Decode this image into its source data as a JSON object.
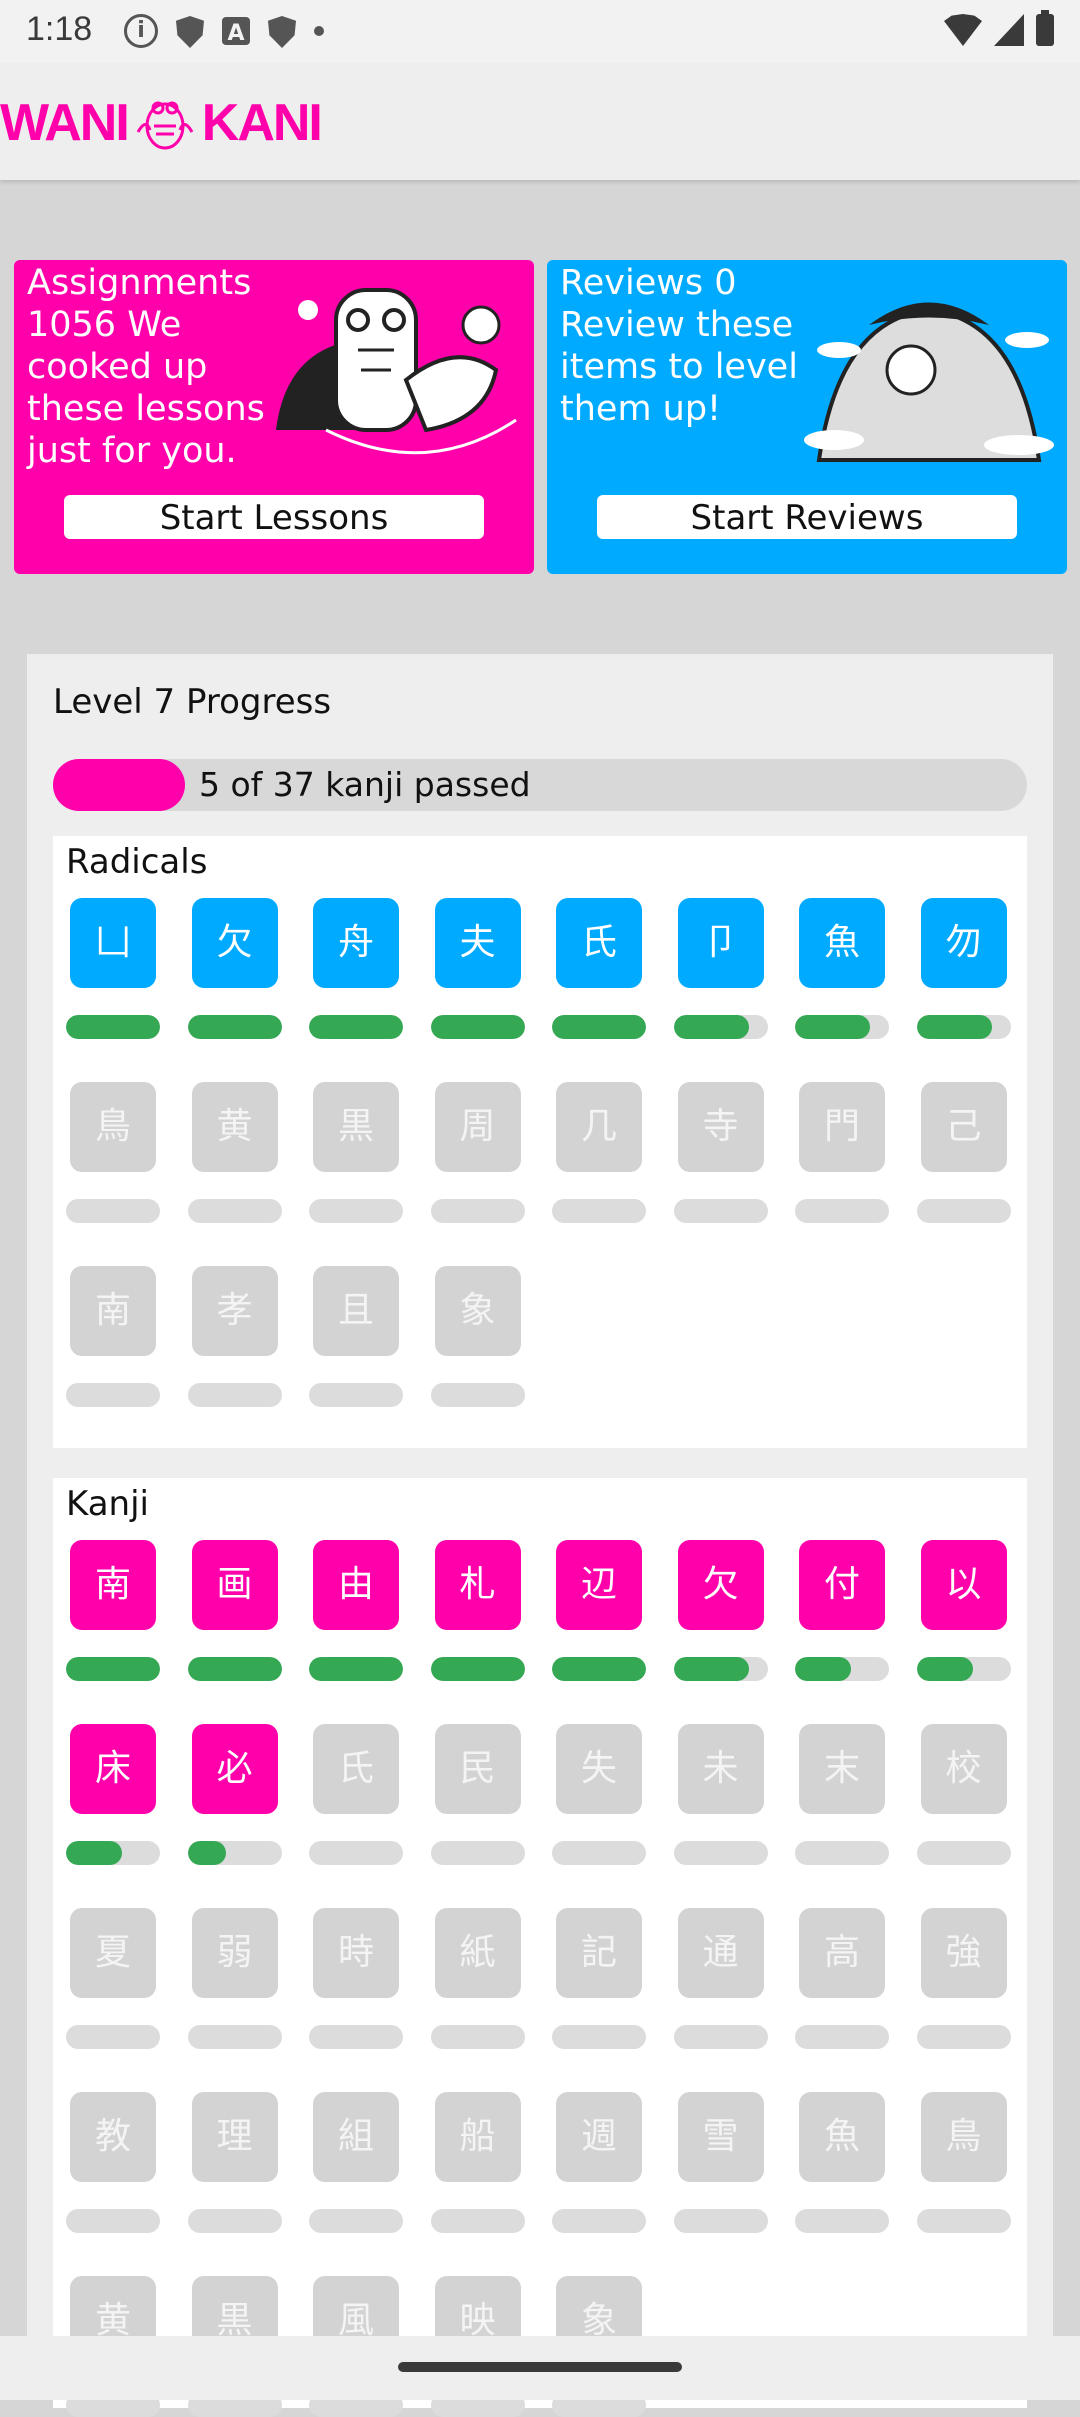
{
  "status_bar": {
    "time": "1:18"
  },
  "app_bar": {
    "logo_left": "WANI",
    "logo_right": "KANI"
  },
  "lessons_card": {
    "text": "Assignments 1056 We cooked up these lessons just for you.",
    "button": "Start Lessons",
    "color": "#ff00aa"
  },
  "reviews_card": {
    "text": "Reviews 0 Review these items to level them up!",
    "button": "Start Reviews",
    "color": "#00aaff"
  },
  "progress": {
    "title": "Level 7 Progress",
    "text": "5 of 37 kanji passed",
    "passed": 5,
    "total": 37
  },
  "radicals": {
    "title": "Radicals",
    "items": [
      {
        "char": "凵",
        "state": "unlocked",
        "progress": 1.0
      },
      {
        "char": "欠",
        "state": "unlocked",
        "progress": 1.0
      },
      {
        "char": "舟",
        "state": "unlocked",
        "progress": 1.0
      },
      {
        "char": "夫",
        "state": "unlocked",
        "progress": 1.0
      },
      {
        "char": "氏",
        "state": "unlocked",
        "progress": 1.0
      },
      {
        "char": "卩",
        "state": "unlocked",
        "progress": 0.8
      },
      {
        "char": "魚",
        "state": "unlocked",
        "progress": 0.8
      },
      {
        "char": "勿",
        "state": "unlocked",
        "progress": 0.8
      },
      {
        "char": "鳥",
        "state": "locked",
        "progress": 0
      },
      {
        "char": "黄",
        "state": "locked",
        "progress": 0
      },
      {
        "char": "黒",
        "state": "locked",
        "progress": 0
      },
      {
        "char": "周",
        "state": "locked",
        "progress": 0
      },
      {
        "char": "几",
        "state": "locked",
        "progress": 0
      },
      {
        "char": "寺",
        "state": "locked",
        "progress": 0
      },
      {
        "char": "門",
        "state": "locked",
        "progress": 0
      },
      {
        "char": "己",
        "state": "locked",
        "progress": 0
      },
      {
        "char": "南",
        "state": "locked",
        "progress": 0
      },
      {
        "char": "孝",
        "state": "locked",
        "progress": 0
      },
      {
        "char": "且",
        "state": "locked",
        "progress": 0
      },
      {
        "char": "象",
        "state": "locked",
        "progress": 0
      }
    ]
  },
  "kanji": {
    "title": "Kanji",
    "items": [
      {
        "char": "南",
        "state": "unlocked",
        "progress": 1.0
      },
      {
        "char": "画",
        "state": "unlocked",
        "progress": 1.0
      },
      {
        "char": "由",
        "state": "unlocked",
        "progress": 1.0
      },
      {
        "char": "札",
        "state": "unlocked",
        "progress": 1.0
      },
      {
        "char": "辺",
        "state": "unlocked",
        "progress": 1.0
      },
      {
        "char": "欠",
        "state": "unlocked",
        "progress": 0.8
      },
      {
        "char": "付",
        "state": "unlocked",
        "progress": 0.6
      },
      {
        "char": "以",
        "state": "unlocked",
        "progress": 0.6
      },
      {
        "char": "床",
        "state": "unlocked",
        "progress": 0.6
      },
      {
        "char": "必",
        "state": "unlocked",
        "progress": 0.4
      },
      {
        "char": "氏",
        "state": "locked",
        "progress": 0
      },
      {
        "char": "民",
        "state": "locked",
        "progress": 0
      },
      {
        "char": "失",
        "state": "locked",
        "progress": 0
      },
      {
        "char": "未",
        "state": "locked",
        "progress": 0
      },
      {
        "char": "末",
        "state": "locked",
        "progress": 0
      },
      {
        "char": "校",
        "state": "locked",
        "progress": 0
      },
      {
        "char": "夏",
        "state": "locked",
        "progress": 0
      },
      {
        "char": "弱",
        "state": "locked",
        "progress": 0
      },
      {
        "char": "時",
        "state": "locked",
        "progress": 0
      },
      {
        "char": "紙",
        "state": "locked",
        "progress": 0
      },
      {
        "char": "記",
        "state": "locked",
        "progress": 0
      },
      {
        "char": "通",
        "state": "locked",
        "progress": 0
      },
      {
        "char": "高",
        "state": "locked",
        "progress": 0
      },
      {
        "char": "強",
        "state": "locked",
        "progress": 0
      },
      {
        "char": "教",
        "state": "locked",
        "progress": 0
      },
      {
        "char": "理",
        "state": "locked",
        "progress": 0
      },
      {
        "char": "組",
        "state": "locked",
        "progress": 0
      },
      {
        "char": "船",
        "state": "locked",
        "progress": 0
      },
      {
        "char": "週",
        "state": "locked",
        "progress": 0
      },
      {
        "char": "雪",
        "state": "locked",
        "progress": 0
      },
      {
        "char": "魚",
        "state": "locked",
        "progress": 0
      },
      {
        "char": "鳥",
        "state": "locked",
        "progress": 0
      },
      {
        "char": "黄",
        "state": "locked",
        "progress": 0
      },
      {
        "char": "黒",
        "state": "locked",
        "progress": 0
      },
      {
        "char": "風",
        "state": "locked",
        "progress": 0
      },
      {
        "char": "映",
        "state": "locked",
        "progress": 0
      },
      {
        "char": "象",
        "state": "locked",
        "progress": 0
      }
    ]
  },
  "colors": {
    "radical": "#00aaff",
    "kanji": "#ff00aa",
    "locked": "#d3d3d3",
    "progress_bar": "#34a853"
  }
}
